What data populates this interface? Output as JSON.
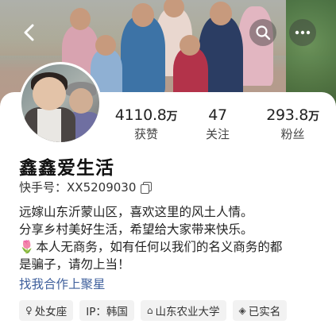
{
  "stats": [
    {
      "value": "4110.8",
      "unit": "万",
      "label": "获赞"
    },
    {
      "value": "47",
      "unit": "",
      "label": "关注"
    },
    {
      "value": "293.8",
      "unit": "万",
      "label": "粉丝"
    }
  ],
  "profile": {
    "name": "鑫鑫爱生活",
    "id_label": "快手号：",
    "id_value": "XX5209030"
  },
  "bio": {
    "line1": "远嫁山东沂蒙山区，喜欢这里的风土人情。",
    "line2": "分享乡村美好生活，希望给大家带来快乐。",
    "line3_icon": "🌷",
    "line3": "本人无商务，如有任何以我们的名义商务的都",
    "line4": "是骗子，请勿上当！"
  },
  "link": "找我合作上聚星",
  "tags": [
    {
      "icon": "female-icon",
      "glyph": "♀",
      "text": "处女座"
    },
    {
      "icon": "",
      "glyph": "",
      "text": "IP：韩国"
    },
    {
      "icon": "school-icon",
      "glyph": "⌂",
      "text": "山东农业大学"
    },
    {
      "icon": "verified-icon",
      "glyph": "◈",
      "text": "已实名"
    }
  ],
  "colors": {
    "link": "#3e5f9c",
    "tag_bg": "#f2f2f2"
  }
}
